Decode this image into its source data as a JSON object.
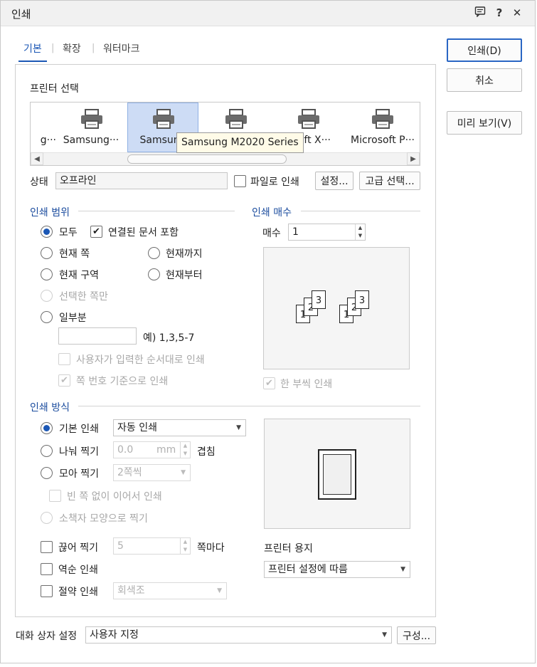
{
  "window": {
    "title": "인쇄",
    "help_label": "?",
    "close_label": "✕"
  },
  "tabs": [
    "기본",
    "확장",
    "워터마크"
  ],
  "printer": {
    "section_label": "프린터 선택",
    "items": [
      "g···",
      "Samsung···",
      "Samsung",
      "osoft X···",
      "Microsoft P···"
    ],
    "tooltip": "Samsung M2020 Series",
    "status_label": "상태",
    "status_value": "오프라인",
    "print_to_file_label": "파일로 인쇄",
    "settings_label": "설정...",
    "advanced_label": "고급 선택..."
  },
  "range": {
    "section_label": "인쇄 범위",
    "all_label": "모두",
    "include_linked_label": "연결된 문서 포함",
    "current_page_label": "현재 쪽",
    "to_current_label": "현재까지",
    "current_section_label": "현재 구역",
    "from_current_label": "현재부터",
    "selected_only_label": "선택한 쪽만",
    "partial_label": "일부분",
    "partial_example": "예) 1,3,5-7",
    "user_order_label": "사용자가 입력한 순서대로 인쇄",
    "page_number_label": "쪽 번호 기준으로 인쇄"
  },
  "copies": {
    "section_label": "인쇄 매수",
    "count_label": "매수",
    "count_value": "1",
    "collate_label": "한 부씩 인쇄",
    "page_labels": [
      "1",
      "2",
      "3"
    ]
  },
  "method": {
    "section_label": "인쇄 방식",
    "basic_label": "기본 인쇄",
    "basic_value": "자동 인쇄",
    "split_label": "나눠 찍기",
    "split_value": "0.0",
    "split_unit": "mm",
    "overlap_label": "겹침",
    "collect_label": "모아 찍기",
    "collect_value": "2쪽씩",
    "no_blank_label": "빈 쪽 없이 이어서 인쇄",
    "booklet_label": "소책자 모양으로 찍기",
    "break_label": "끊어 찍기",
    "break_value": "5",
    "break_unit": "쪽마다",
    "reverse_label": "역순 인쇄",
    "saving_label": "절약 인쇄",
    "saving_value": "회색조",
    "paper_label": "프린터 용지",
    "paper_value": "프린터 설정에 따름"
  },
  "buttons": {
    "print_label": "인쇄(D)",
    "cancel_label": "취소",
    "preview_label": "미리 보기(V)"
  },
  "footer": {
    "dialog_settings_label": "대화 상자 설정",
    "dialog_settings_value": "사용자 지정",
    "configure_label": "구성..."
  },
  "colors": {
    "accent": "#1b57b5",
    "section": "#1b4c9e",
    "selected_printer": "#cddcf5",
    "tooltip_bg": "#fffbe8"
  }
}
